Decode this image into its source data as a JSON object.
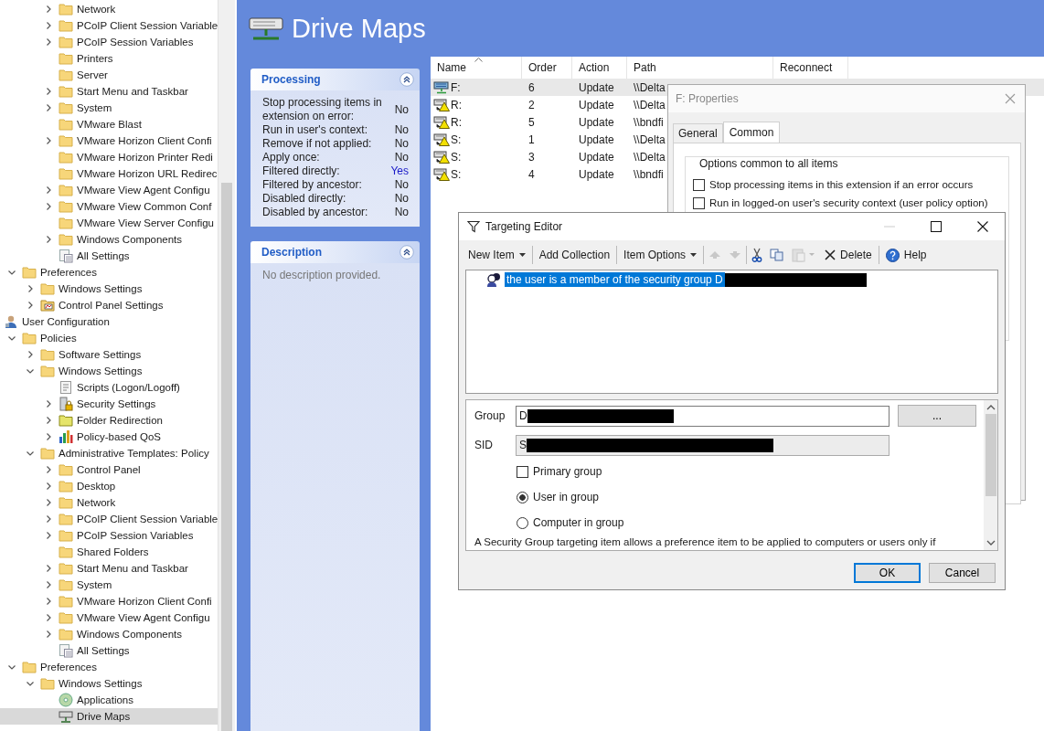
{
  "tree": [
    {
      "children": [
        {
          "children": [
            {
              "children": [
                {
                  "label": "Network",
                  "kind": "folder",
                  "expanded": false,
                  "selected": false
                },
                {
                  "label": "PCoIP Client Session Variable",
                  "kind": "folder",
                  "expanded": false,
                  "selected": false
                },
                {
                  "label": "PCoIP Session Variables",
                  "kind": "folder",
                  "expanded": false,
                  "selected": false
                },
                {
                  "label": "Printers",
                  "kind": "folder",
                  "selected": false
                },
                {
                  "label": "Server",
                  "kind": "folder",
                  "selected": false
                },
                {
                  "label": "Start Menu and Taskbar",
                  "kind": "folder",
                  "expanded": false,
                  "selected": false
                },
                {
                  "label": "System",
                  "kind": "folder",
                  "expanded": false,
                  "selected": false
                },
                {
                  "label": "VMware Blast",
                  "kind": "folder",
                  "selected": false
                },
                {
                  "label": "VMware Horizon Client Confi",
                  "kind": "folder",
                  "expanded": false,
                  "selected": false
                },
                {
                  "label": "VMware Horizon Printer Redi",
                  "kind": "folder",
                  "selected": false
                },
                {
                  "label": "VMware Horizon URL Redirec",
                  "kind": "folder",
                  "selected": false
                },
                {
                  "label": "VMware View Agent Configu",
                  "kind": "folder",
                  "expanded": false,
                  "selected": false
                },
                {
                  "label": "VMware View Common Conf",
                  "kind": "folder",
                  "expanded": false,
                  "selected": false
                },
                {
                  "label": "VMware View Server Configu",
                  "kind": "folder",
                  "selected": false
                },
                {
                  "label": "Windows Components",
                  "kind": "folder",
                  "expanded": false,
                  "selected": false
                },
                {
                  "label": "All Settings",
                  "kind": "all-settings",
                  "selected": false
                }
              ]
            }
          ]
        },
        {
          "label": "Preferences",
          "kind": "folder",
          "expanded": true,
          "selected": false,
          "children": [
            {
              "label": "Windows Settings",
              "kind": "folder",
              "expanded": false,
              "selected": false
            },
            {
              "label": "Control Panel Settings",
              "kind": "control-panel",
              "expanded": false,
              "selected": false
            }
          ]
        }
      ]
    },
    {
      "label": "User Configuration",
      "kind": "user",
      "selected": false,
      "children": [
        {
          "label": "Policies",
          "kind": "folder",
          "expanded": true,
          "selected": false,
          "children": [
            {
              "label": "Software Settings",
              "kind": "folder",
              "expanded": false,
              "selected": false
            },
            {
              "label": "Windows Settings",
              "kind": "folder",
              "expanded": true,
              "selected": false,
              "children": [
                {
                  "label": "Scripts (Logon/Logoff)",
                  "kind": "scripts",
                  "selected": false
                },
                {
                  "label": "Security Settings",
                  "kind": "security",
                  "expanded": false,
                  "selected": false
                },
                {
                  "label": "Folder Redirection",
                  "kind": "folder-redirection",
                  "expanded": false,
                  "selected": false
                },
                {
                  "label": "Policy-based QoS",
                  "kind": "qos",
                  "expanded": false,
                  "selected": false
                }
              ]
            },
            {
              "label": "Administrative Templates: Policy",
              "kind": "folder",
              "expanded": true,
              "selected": false,
              "children": [
                {
                  "label": "Control Panel",
                  "kind": "folder",
                  "expanded": false,
                  "selected": false
                },
                {
                  "label": "Desktop",
                  "kind": "folder",
                  "expanded": false,
                  "selected": false
                },
                {
                  "label": "Network",
                  "kind": "folder",
                  "expanded": false,
                  "selected": false
                },
                {
                  "label": "PCoIP Client Session Variable",
                  "kind": "folder",
                  "expanded": false,
                  "selected": false
                },
                {
                  "label": "PCoIP Session Variables",
                  "kind": "folder",
                  "expanded": false,
                  "selected": false
                },
                {
                  "label": "Shared Folders",
                  "kind": "folder",
                  "selected": false
                },
                {
                  "label": "Start Menu and Taskbar",
                  "kind": "folder",
                  "expanded": false,
                  "selected": false
                },
                {
                  "label": "System",
                  "kind": "folder",
                  "expanded": false,
                  "selected": false
                },
                {
                  "label": "VMware Horizon Client Confi",
                  "kind": "folder",
                  "expanded": false,
                  "selected": false
                },
                {
                  "label": "VMware View Agent Configu",
                  "kind": "folder",
                  "expanded": false,
                  "selected": false
                },
                {
                  "label": "Windows Components",
                  "kind": "folder",
                  "expanded": false,
                  "selected": false
                },
                {
                  "label": "All Settings",
                  "kind": "all-settings",
                  "selected": false
                }
              ]
            }
          ]
        },
        {
          "label": "Preferences",
          "kind": "folder",
          "expanded": true,
          "selected": false,
          "children": [
            {
              "label": "Windows Settings",
              "kind": "folder",
              "expanded": true,
              "selected": false,
              "children": [
                {
                  "label": "Applications",
                  "kind": "applications",
                  "selected": false
                },
                {
                  "label": "Drive Maps",
                  "kind": "drive-maps",
                  "selected": true
                }
              ]
            }
          ]
        }
      ]
    }
  ],
  "header": {
    "title": "Drive Maps"
  },
  "processing": {
    "title": "Processing",
    "rows": [
      {
        "label": "Stop processing items in extension on error:",
        "value": "No",
        "emphasized": false
      },
      {
        "label": "Run in user's context:",
        "value": "No",
        "emphasized": false
      },
      {
        "label": "Remove if not applied:",
        "value": "No",
        "emphasized": false
      },
      {
        "label": "Apply once:",
        "value": "No",
        "emphasized": false
      },
      {
        "label": "Filtered directly:",
        "value": "Yes",
        "emphasized": true
      },
      {
        "label": "Filtered by ancestor:",
        "value": "No",
        "emphasized": false
      },
      {
        "label": "Disabled directly:",
        "value": "No",
        "emphasized": false
      },
      {
        "label": "Disabled by ancestor:",
        "value": "No",
        "emphasized": false
      }
    ]
  },
  "description": {
    "title": "Description",
    "text": "No description provided."
  },
  "table": {
    "columns": [
      {
        "label": "Name",
        "sorted": true
      },
      {
        "label": "Order",
        "sorted": false
      },
      {
        "label": "Action",
        "sorted": false
      },
      {
        "label": "Path",
        "sorted": false
      },
      {
        "label": "Reconnect",
        "sorted": false
      }
    ],
    "rows": [
      {
        "name": "F:",
        "order": "6",
        "action": "Update",
        "path": "\\\\Delta",
        "kind": "connected",
        "selected": true
      },
      {
        "name": "R:",
        "order": "2",
        "action": "Update",
        "path": "\\\\Delta",
        "kind": "warning",
        "selected": false
      },
      {
        "name": "R:",
        "order": "5",
        "action": "Update",
        "path": "\\\\bndfi",
        "kind": "warning",
        "selected": false
      },
      {
        "name": "S:",
        "order": "1",
        "action": "Update",
        "path": "\\\\Delta",
        "kind": "warning",
        "selected": false
      },
      {
        "name": "S:",
        "order": "3",
        "action": "Update",
        "path": "\\\\Delta",
        "kind": "warning",
        "selected": false
      },
      {
        "name": "S:",
        "order": "4",
        "action": "Update",
        "path": "\\\\bndfi",
        "kind": "warning",
        "selected": false
      }
    ]
  },
  "properties_dialog": {
    "title": "F: Properties",
    "tabs": [
      {
        "label": "General",
        "selected": false
      },
      {
        "label": "Common",
        "selected": true
      }
    ],
    "group": "Options common to all items",
    "options": [
      {
        "label": "Stop processing items in this extension if an error occurs",
        "checked": false
      },
      {
        "label": "Run in logged-on user's security context (user policy option)",
        "checked": false
      }
    ]
  },
  "targeting_editor": {
    "title": "Targeting Editor",
    "toolbar": [
      {
        "kind": "menu",
        "label": "New Item",
        "disabled": false
      },
      {
        "kind": "separator"
      },
      {
        "kind": "button",
        "label": "Add Collection",
        "disabled": false
      },
      {
        "kind": "separator"
      },
      {
        "kind": "menu",
        "label": "Item Options",
        "disabled": false
      },
      {
        "kind": "separator"
      },
      {
        "kind": "move-up",
        "disabled": true
      },
      {
        "kind": "move-down",
        "disabled": true
      },
      {
        "kind": "separator"
      },
      {
        "kind": "cut",
        "disabled": false
      },
      {
        "kind": "copy",
        "disabled": false
      },
      {
        "kind": "paste",
        "disabled": true
      },
      {
        "kind": "delete",
        "label": "Delete",
        "disabled": false
      },
      {
        "kind": "separator"
      },
      {
        "kind": "help",
        "label": "Help",
        "disabled": false
      }
    ],
    "items": [
      {
        "text": "the user is a member of the security group D",
        "redacted": true,
        "selected": true
      }
    ],
    "fields": [
      {
        "label": "Group",
        "value": "D",
        "redacted": true,
        "readonly": false,
        "button": "..."
      },
      {
        "label": "SID",
        "value": "S",
        "redacted": true,
        "readonly": true
      }
    ],
    "primary_group": {
      "label": "Primary group",
      "checked": false
    },
    "scope": [
      {
        "label": "User in group",
        "selected": true
      },
      {
        "label": "Computer in group",
        "selected": false
      }
    ],
    "help_text": "A Security Group targeting item allows a preference item to be applied to computers or users only if",
    "buttons": [
      {
        "label": "OK",
        "default": true
      },
      {
        "label": "Cancel",
        "default": false
      }
    ]
  }
}
